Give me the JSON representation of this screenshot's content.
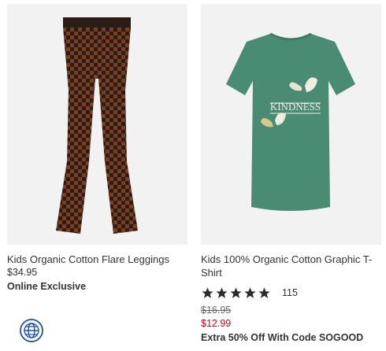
{
  "products": [
    {
      "title": "Kids Organic Cotton Flare Leggings",
      "price": "$34.95",
      "badge": "Online Exclusive",
      "image_icon": "checkered-flare-leggings",
      "colors": {
        "check_dark": "#2b1d16",
        "check_light": "#7a3f22"
      }
    },
    {
      "title": "Kids 100% Organic Cotton Graphic T-Shirt",
      "rating_value": 5,
      "review_count": "115",
      "original_price": "$16.95",
      "sale_price": "$12.99",
      "promo": "Extra 50% Off With Code SOGOOD",
      "image_icon": "green-butterfly-tshirt",
      "graphic_text": "KINDNESS",
      "colors": {
        "shirt": "#4a8b74",
        "sale": "#d0021b"
      }
    }
  ],
  "footer": {
    "globe_icon": "globe-icon"
  }
}
